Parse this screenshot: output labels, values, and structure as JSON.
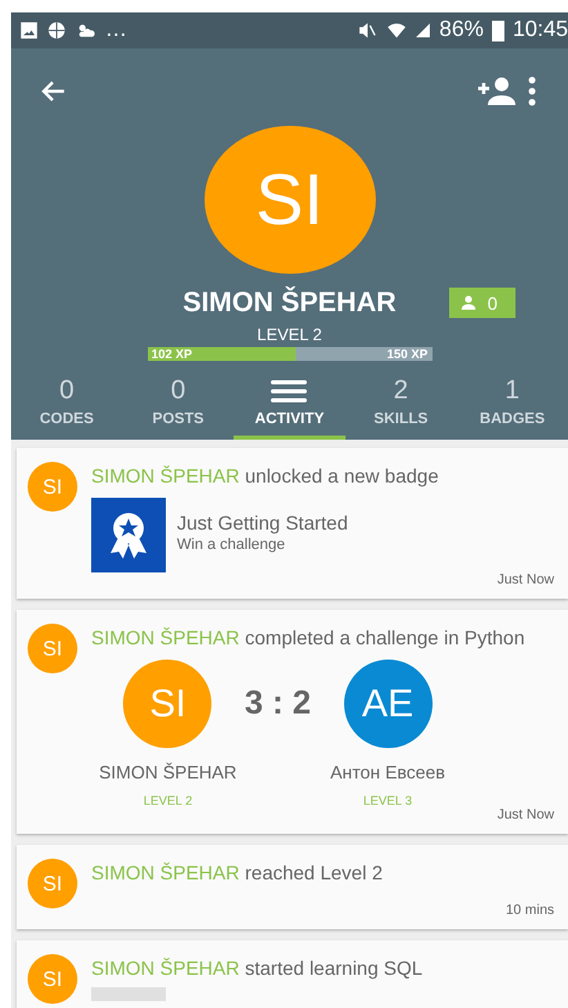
{
  "status_bar": {
    "overflow": "…",
    "battery": "86%",
    "time": "10:45"
  },
  "profile": {
    "initials": "SI",
    "name": "SIMON ŠPEHAR",
    "followers": "0",
    "level": "LEVEL 2",
    "xp": {
      "current": "102 XP",
      "next": "150 XP",
      "level": 0.52
    }
  },
  "tabs": [
    {
      "count": "0",
      "label": "CODES",
      "selected": false
    },
    {
      "count": "0",
      "label": "POSTS",
      "selected": false
    },
    {
      "label": "ACTIVITY",
      "selected": true
    },
    {
      "count": "2",
      "label": "SKILLS",
      "selected": false
    },
    {
      "count": "1",
      "label": "BADGES",
      "selected": false
    }
  ],
  "feed": [
    {
      "kind": "badge",
      "initials": "SI",
      "actor": "SIMON ŠPEHAR",
      "action": "unlocked a new badge",
      "badge": {
        "title": "Just Getting Started",
        "subtitle": "Win a challenge"
      },
      "time": "Just Now"
    },
    {
      "kind": "challenge",
      "initials": "SI",
      "actor": "SIMON ŠPEHAR",
      "action": "completed a challenge in Python",
      "score": "3 : 2",
      "players": [
        {
          "initials": "SI",
          "name": "SIMON ŠPEHAR",
          "level": "LEVEL 2",
          "color": "#ff9f00"
        },
        {
          "initials": "AE",
          "name": "Антон Евсеев",
          "level": "LEVEL 3",
          "color": "#0a8ad3"
        }
      ],
      "time": "Just Now"
    },
    {
      "kind": "level",
      "initials": "SI",
      "actor": "SIMON ŠPEHAR",
      "action": "reached Level 2",
      "time": "10 mins"
    },
    {
      "kind": "course",
      "initials": "SI",
      "actor": "SIMON ŠPEHAR",
      "action": "started learning SQL"
    }
  ]
}
